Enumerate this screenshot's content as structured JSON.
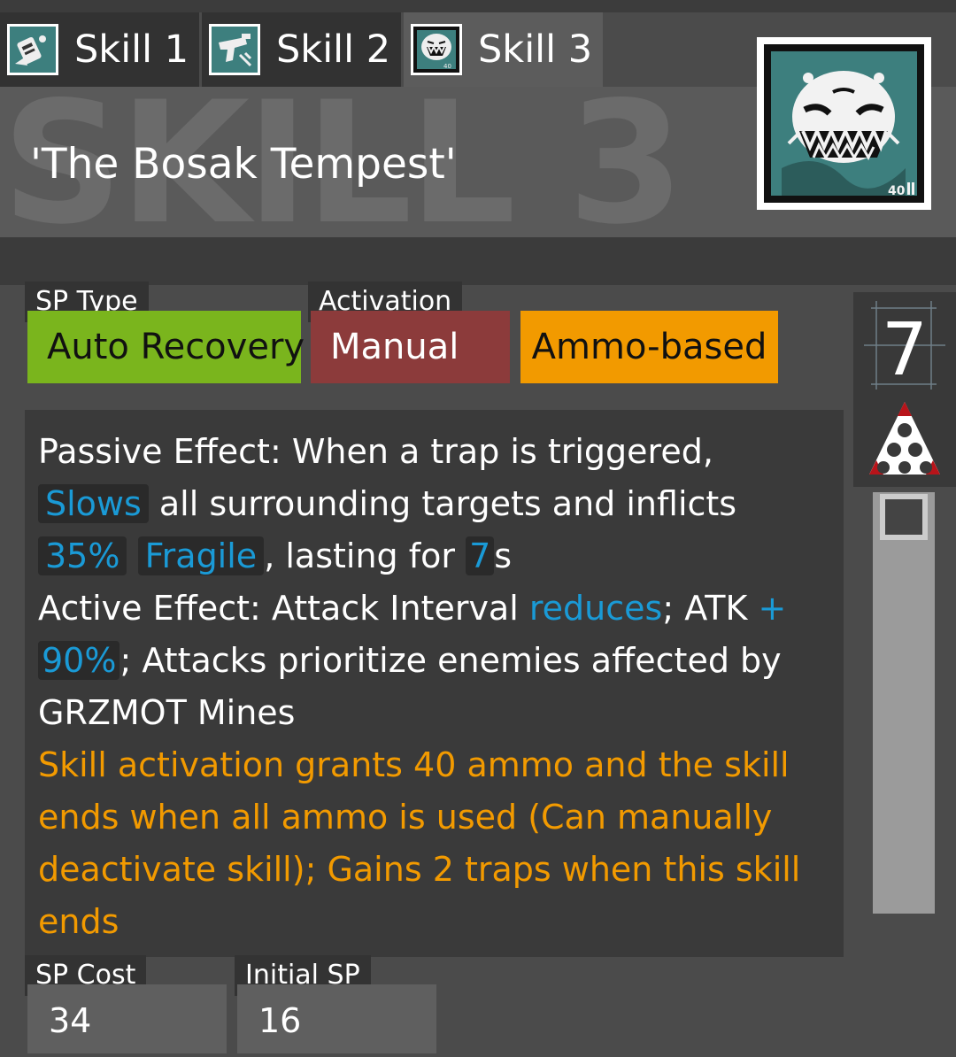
{
  "tabs": [
    {
      "label": "Skill 1",
      "icon": "skill1-icon"
    },
    {
      "label": "Skill 2",
      "icon": "skill2-icon"
    },
    {
      "label": "Skill 3",
      "icon": "skill3-icon",
      "active": true
    }
  ],
  "header": {
    "watermark": "SKILL 3",
    "title": "'The Bosak Tempest'",
    "icon_badge": "40"
  },
  "fields": {
    "sp_type_label": "SP Type",
    "activation_label": "Activation",
    "sp_type_value": "Auto Recovery",
    "activation_value": "Manual",
    "extra_value": "Ammo-based"
  },
  "level": {
    "value": "7",
    "mastery_icon": "mastery-triangle-icon"
  },
  "description": {
    "p1_a": "Passive Effect: When a trap is triggered, ",
    "p1_kw1": "Slows",
    "p1_b": " all surrounding targets and inflicts ",
    "p1_kw2": "35%",
    "p1_kw3": "Fragile",
    "p1_c": ", lasting for ",
    "p1_kw4": "7",
    "p1_d": "s",
    "p2_a": "Active Effect: Attack Interval ",
    "p2_kw1": "reduces",
    "p2_b": "; ATK ",
    "p2_kw2": "+",
    "p2_kw3": "90%",
    "p2_c": "; Attacks prioritize enemies affected by GRZMOT Mines",
    "p3": "Skill activation grants 40 ammo and the skill ends when all ammo is used (Can manually deactivate skill); Gains 2 traps when this skill ends"
  },
  "costs": {
    "sp_cost_label": "SP Cost",
    "sp_cost_value": "34",
    "initial_sp_label": "Initial SP",
    "initial_sp_value": "16"
  },
  "colors": {
    "green": "#7ab51d",
    "red": "#8c3b3b",
    "orange": "#f29a00",
    "keyword_blue": "#1a9ad6",
    "icon_teal": "#3d7f7e"
  }
}
